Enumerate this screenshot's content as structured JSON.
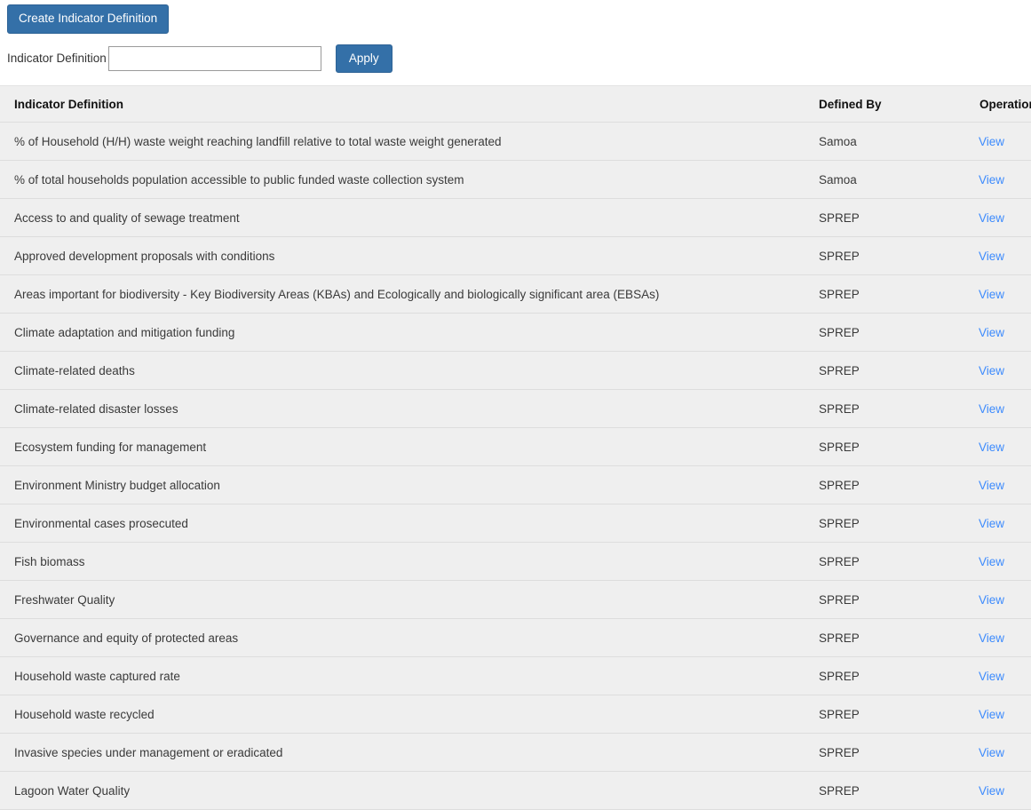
{
  "toolbar": {
    "create_button_label": "Create Indicator Definition"
  },
  "filter": {
    "label": "Indicator Definition",
    "input_value": "",
    "input_placeholder": "",
    "apply_button_label": "Apply"
  },
  "table": {
    "columns": {
      "definition": "Indicator Definition",
      "defined_by": "Defined By",
      "operations": "Operations"
    },
    "view_link_label": "View",
    "rows": [
      {
        "definition": "% of Household (H/H) waste weight reaching landfill relative to total waste weight generated",
        "defined_by": "Samoa",
        "operation": "View"
      },
      {
        "definition": "% of total households population accessible to public funded waste collection system",
        "defined_by": "Samoa",
        "operation": "View"
      },
      {
        "definition": "Access to and quality of sewage treatment",
        "defined_by": "SPREP",
        "operation": "View"
      },
      {
        "definition": "Approved development proposals with conditions",
        "defined_by": "SPREP",
        "operation": "View"
      },
      {
        "definition": "Areas important for biodiversity - Key Biodiversity Areas (KBAs) and Ecologically and biologically significant area (EBSAs)",
        "defined_by": "SPREP",
        "operation": "View"
      },
      {
        "definition": "Climate adaptation and mitigation funding",
        "defined_by": "SPREP",
        "operation": "View"
      },
      {
        "definition": "Climate-related deaths",
        "defined_by": "SPREP",
        "operation": "View"
      },
      {
        "definition": "Climate-related disaster losses",
        "defined_by": "SPREP",
        "operation": "View"
      },
      {
        "definition": "Ecosystem funding for management",
        "defined_by": "SPREP",
        "operation": "View"
      },
      {
        "definition": "Environment Ministry budget allocation",
        "defined_by": "SPREP",
        "operation": "View"
      },
      {
        "definition": "Environmental cases prosecuted",
        "defined_by": "SPREP",
        "operation": "View"
      },
      {
        "definition": "Fish biomass",
        "defined_by": "SPREP",
        "operation": "View"
      },
      {
        "definition": "Freshwater Quality",
        "defined_by": "SPREP",
        "operation": "View"
      },
      {
        "definition": "Governance and equity of protected areas",
        "defined_by": "SPREP",
        "operation": "View"
      },
      {
        "definition": "Household waste captured rate",
        "defined_by": "SPREP",
        "operation": "View"
      },
      {
        "definition": "Household waste recycled",
        "defined_by": "SPREP",
        "operation": "View"
      },
      {
        "definition": "Invasive species under management or eradicated",
        "defined_by": "SPREP",
        "operation": "View"
      },
      {
        "definition": "Lagoon Water Quality",
        "defined_by": "SPREP",
        "operation": "View"
      }
    ]
  },
  "colors": {
    "primary_button": "#3470a8",
    "row_background": "#efefef",
    "link": "#3d8bfd",
    "text": "#333333"
  }
}
